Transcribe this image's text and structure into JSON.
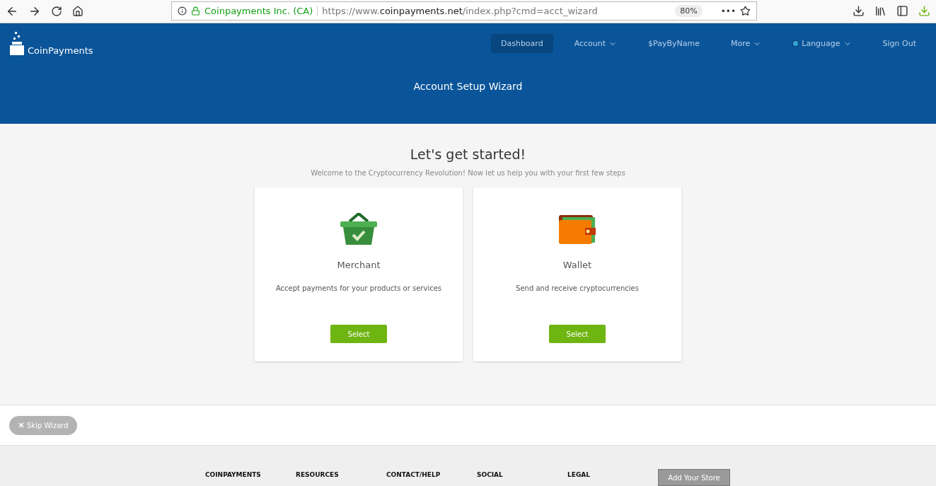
{
  "browser": {
    "site_identity": "Coinpayments Inc. (CA)",
    "url_prefix": "https://www.",
    "url_domain": "coinpayments.net",
    "url_path": "/index.php?cmd=acct_wizard",
    "zoom": "80%",
    "more": "•••"
  },
  "header": {
    "brand": "CoinPayments",
    "nav": [
      {
        "label": "Dashboard",
        "selected": true,
        "dropdown": false,
        "globe": false
      },
      {
        "label": "Account",
        "selected": false,
        "dropdown": true,
        "globe": false
      },
      {
        "label": "$PayByName",
        "selected": false,
        "dropdown": false,
        "globe": false
      },
      {
        "label": "More",
        "selected": false,
        "dropdown": true,
        "globe": false
      },
      {
        "label": "Language",
        "selected": false,
        "dropdown": true,
        "globe": true
      },
      {
        "label": "Sign Out",
        "selected": false,
        "dropdown": false,
        "globe": false
      }
    ],
    "page_title": "Account Setup Wizard"
  },
  "main": {
    "heading": "Let's get started!",
    "subheading": "Welcome to the Cryptocurrency Revolution! Now let us help you with your first few steps",
    "cards": [
      {
        "kind": "basket",
        "title": "Merchant",
        "description": "Accept payments for your products or services",
        "button": "Select"
      },
      {
        "kind": "wallet",
        "title": "Wallet",
        "description": "Send and receive cryptocurrencies",
        "button": "Select"
      }
    ]
  },
  "skip_button": "Skip Wizard",
  "footer": {
    "columns": [
      "COINPAYMENTS",
      "RESOURCES",
      "CONTACT/HELP",
      "SOCIAL",
      "LEGAL"
    ],
    "store_button": "Add Your Store"
  }
}
